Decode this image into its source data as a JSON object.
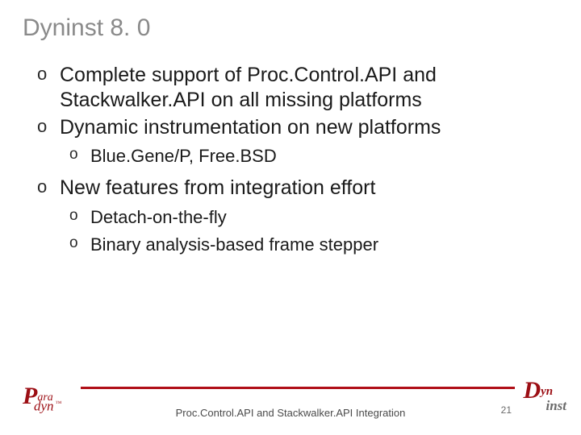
{
  "title": "Dyninst 8. 0",
  "bullets": {
    "b1": "Complete support of Proc.Control.API and Stackwalker.API on all missing platforms",
    "b2": "Dynamic instrumentation on new platforms",
    "b2_1": "Blue.Gene/P,  Free.BSD",
    "b3": "New features from integration effort",
    "b3_1": "Detach-on-the-fly",
    "b3_2": "Binary analysis-based frame stepper"
  },
  "footer": {
    "text": "Proc.Control.API and Stackwalker.API Integration",
    "page": "21"
  },
  "logos": {
    "paradyn_p": "P",
    "paradyn_ara": "ara",
    "paradyn_dyn": "dyn",
    "paradyn_tm": "™",
    "dyninst_d": "D",
    "dyninst_yn": "yn",
    "dyninst_inst": "inst"
  },
  "colors": {
    "accent": "#b01018",
    "title_gray": "#8a8a8a"
  }
}
